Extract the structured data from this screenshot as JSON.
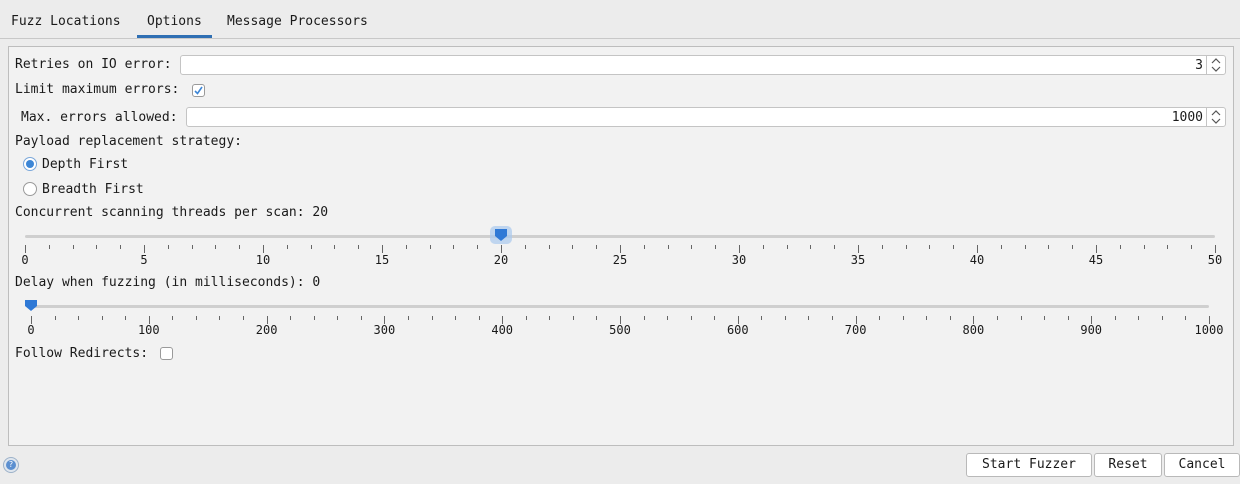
{
  "tabs": [
    "Fuzz Locations",
    "Options",
    "Message Processors"
  ],
  "active_tab": "Options",
  "options": {
    "retries_label": "Retries on IO error:",
    "retries_value": "3",
    "limit_errors_label": "Limit maximum errors:",
    "limit_errors_checked": true,
    "max_errors_label": "Max. errors allowed:",
    "max_errors_value": "1000",
    "strategy_label": "Payload replacement strategy:",
    "strategy_options": [
      "Depth First",
      "Breadth First"
    ],
    "strategy_selected": "Depth First",
    "threads_label": "Concurrent scanning threads per scan: 20",
    "threads_slider": {
      "min": 0,
      "max": 50,
      "value": 20,
      "major_step": 5,
      "minor_step": 1,
      "labels": [
        "0",
        "5",
        "10",
        "15",
        "20",
        "25",
        "30",
        "35",
        "40",
        "45",
        "50"
      ]
    },
    "delay_label": "Delay when fuzzing (in milliseconds): 0",
    "delay_slider": {
      "min": 0,
      "max": 1000,
      "value": 0,
      "major_step": 100,
      "minor_step": 20,
      "labels": [
        "0",
        "100",
        "200",
        "300",
        "400",
        "500",
        "600",
        "700",
        "800",
        "900",
        "1000"
      ]
    },
    "follow_redirects_label": "Follow Redirects:",
    "follow_redirects_checked": false
  },
  "footer": {
    "help_icon": "help-icon",
    "start_label": "Start Fuzzer",
    "reset_label": "Reset",
    "cancel_label": "Cancel"
  },
  "colors": {
    "accent": "#2f6fb3",
    "slider_thumb": "#2f79d6",
    "background": "#ececec"
  }
}
